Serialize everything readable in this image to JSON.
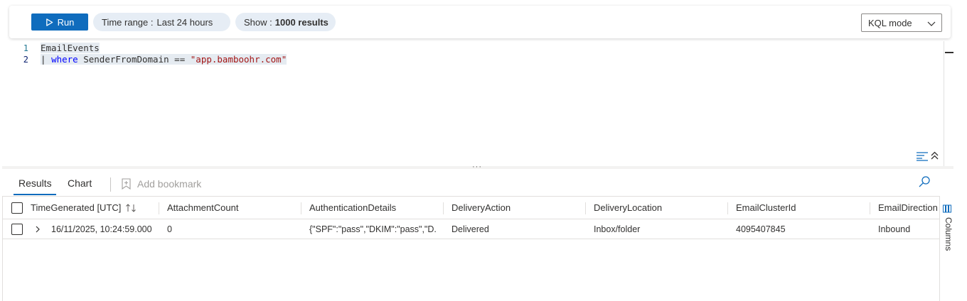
{
  "toolbar": {
    "run_label": "Run",
    "time_range_label": "Time range :",
    "time_range_value": "Last 24 hours",
    "show_label": "Show :",
    "show_value": "1000 results",
    "mode_label": "KQL mode"
  },
  "editor": {
    "line_numbers": [
      "1",
      "2"
    ],
    "lines": [
      {
        "tokens": [
          {
            "t": "EmailEvents",
            "k": "ident"
          }
        ]
      },
      {
        "tokens": [
          {
            "t": "| ",
            "k": "op"
          },
          {
            "t": "where",
            "k": "kw"
          },
          {
            "t": " SenderFromDomain ",
            "k": "ident"
          },
          {
            "t": "==",
            "k": "op"
          },
          {
            "t": " ",
            "k": "op"
          },
          {
            "t": "\"app.bamboohr.com\"",
            "k": "str"
          }
        ]
      }
    ]
  },
  "results": {
    "tabs": [
      "Results",
      "Chart"
    ],
    "active_tab": "Results",
    "add_bookmark_label": "Add bookmark",
    "columns_label": "Columns",
    "columns": [
      "TimeGenerated [UTC]",
      "AttachmentCount",
      "AuthenticationDetails",
      "DeliveryAction",
      "DeliveryLocation",
      "EmailClusterId",
      "EmailDirection"
    ],
    "rows": [
      [
        "16/11/2025, 10:24:59.000",
        "0",
        "{\"SPF\":\"pass\",\"DKIM\":\"pass\",\"D...",
        "Delivered",
        "Inbox/folder",
        "4095407845",
        "Inbound"
      ]
    ]
  },
  "colors": {
    "accent": "#0f6cbd",
    "keyword": "#0000ff",
    "string": "#a31515",
    "selection": "#e5ebf1"
  },
  "icons": {
    "run": "play-icon",
    "mode": "chevron-down-icon",
    "bookmark": "bookmark-icon",
    "search": "search-icon",
    "sort": "sort-icon",
    "expand": "chevron-right-icon",
    "columns": "columns-icon",
    "wrap": "word-wrap-icon",
    "collapse": "collapse-up-icon"
  }
}
